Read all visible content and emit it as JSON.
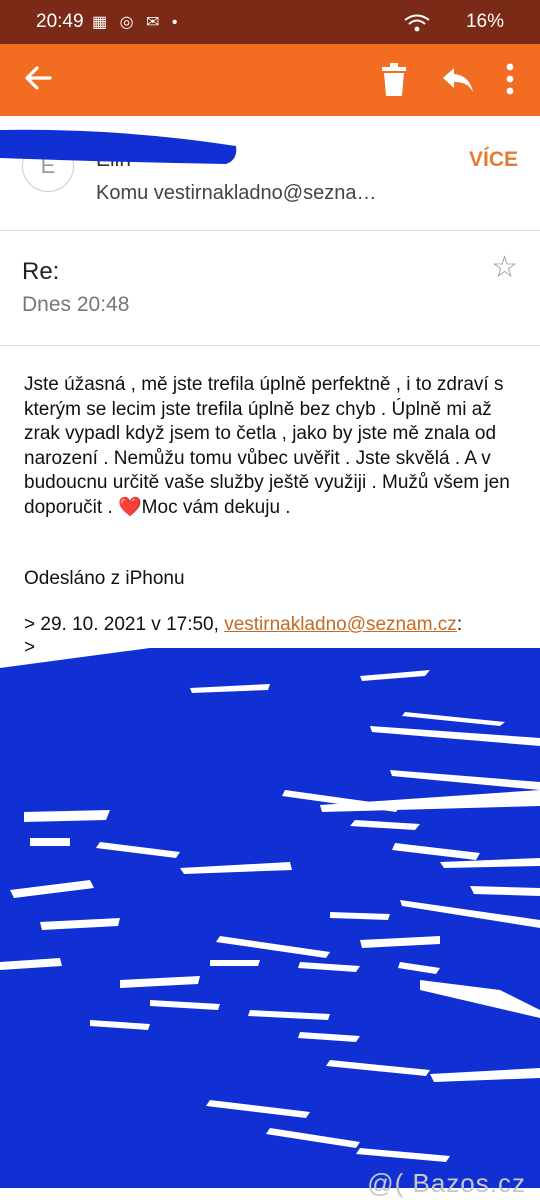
{
  "status": {
    "time": "20:49",
    "battery": "16%",
    "notification_icons": "▦ ◎ ✉ •"
  },
  "appbar": {
    "back_icon": "arrow-left",
    "delete_icon": "trash",
    "reply_icon": "reply",
    "more_icon": "more-vertical"
  },
  "header": {
    "avatar_letter": "E",
    "from": "Eliři",
    "to": "Komu vestirnakladno@sezna…",
    "more_label": "VÍCE"
  },
  "message": {
    "subject": "Re:",
    "date": "Dnes 20:48",
    "body_before_heart": "Jste úžasná , mě jste trefila úplně perfektně , i to zdraví s kterým se lecim jste trefila úplně bez chyb . Úplně mi až zrak vypadl když jsem to četla , jako by jste mě znala od narození . Nemůžu tomu vůbec uvěřit . Jste skvělá . A v budoucnu určitě vaše služby ještě využiji . Mužů všem jen doporučit . ",
    "heart": "❤️",
    "body_after_heart": "Moc vám dekuju .",
    "signature": "Odesláno z iPhonu",
    "quote_prefix": "> 29. 10. 2021 v 17:50, ",
    "quote_email": "vestirnakladno@seznam.cz",
    "quote_suffix": ":",
    "quote_line2": ">"
  },
  "watermark": "@( Bazos.cz"
}
